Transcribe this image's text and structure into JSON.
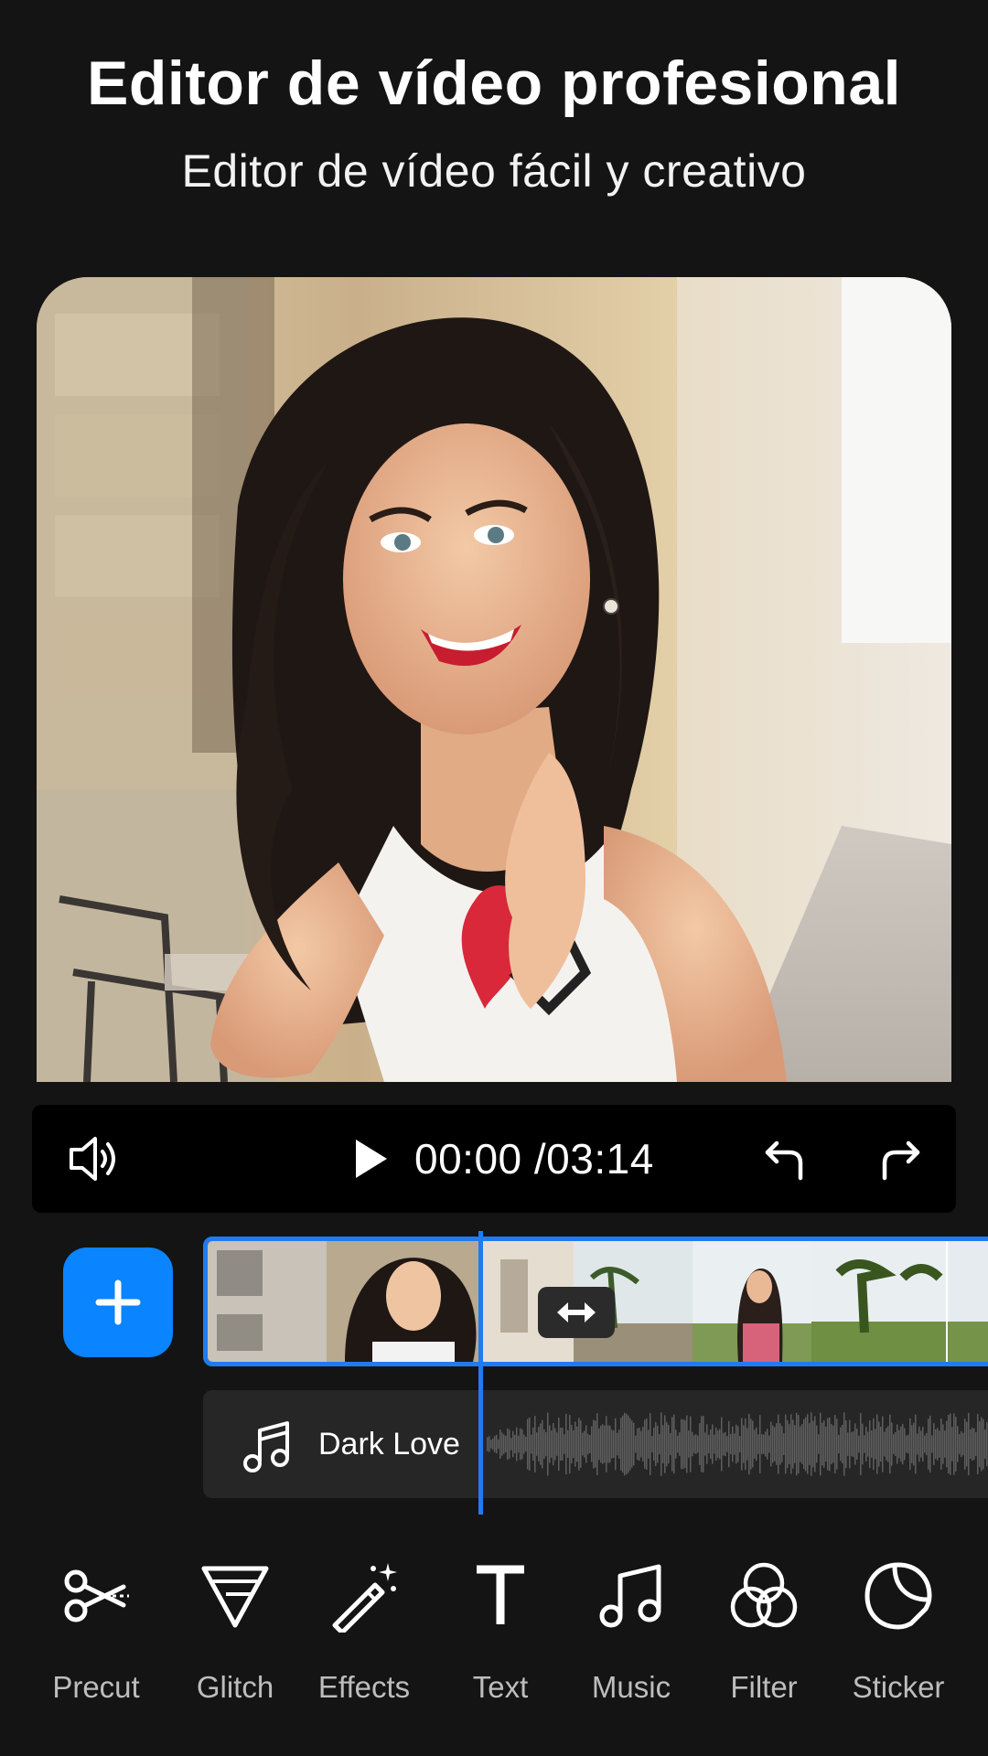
{
  "header": {
    "title": "Editor de vídeo profesional",
    "subtitle": "Editor de vídeo fácil y creativo"
  },
  "player": {
    "current_time": "00:00",
    "total_time": "/03:14"
  },
  "timeline": {
    "audio_track_name": "Dark Love"
  },
  "toolbar": {
    "items": [
      {
        "label": "Precut",
        "icon": "scissors-icon"
      },
      {
        "label": "Glitch",
        "icon": "glitch-triangle-icon"
      },
      {
        "label": "Effects",
        "icon": "magic-wand-icon"
      },
      {
        "label": "Text",
        "icon": "text-t-icon"
      },
      {
        "label": "Music",
        "icon": "music-note-icon"
      },
      {
        "label": "Filter",
        "icon": "filter-circles-icon"
      },
      {
        "label": "Sticker",
        "icon": "sticker-icon"
      }
    ]
  },
  "colors": {
    "background": "#141414",
    "accent": "#0a84ff",
    "control_bar": "#000000",
    "track_bg": "#262626"
  }
}
